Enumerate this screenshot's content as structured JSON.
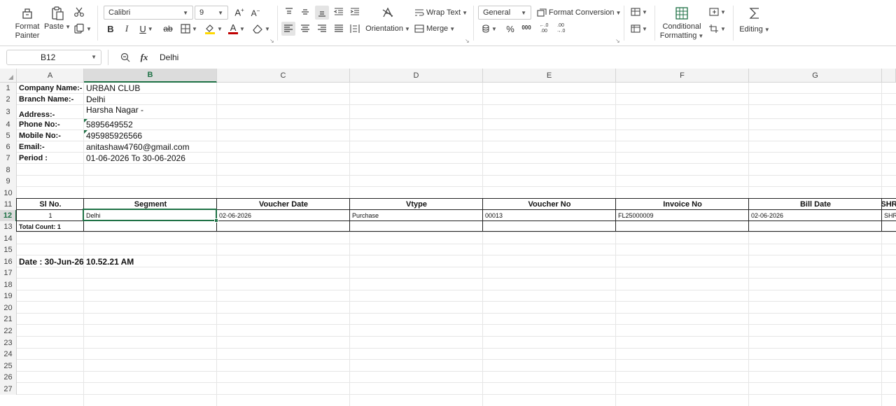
{
  "ribbon": {
    "format_painter_label_1": "Format",
    "format_painter_label_2": "Painter",
    "paste_label": "Paste",
    "font_name": "Calibri",
    "font_size": "9",
    "wrap_text_label": "Wrap Text",
    "orientation_label": "Orientation",
    "merge_label": "Merge",
    "number_format": "General",
    "format_conversion_label": "Format Conversion",
    "conditional_formatting_label_1": "Conditional",
    "conditional_formatting_label_2": "Formatting",
    "editing_label": "Editing",
    "percent_glyph": "%",
    "comma_glyph": "000",
    "increase_decimal_glyph": "←.0 .00",
    "decrease_decimal_glyph": ".00 →.0",
    "bold_glyph": "B",
    "italic_glyph": "I",
    "underline_glyph": "U",
    "strike_glyph": "ab",
    "font_color_glyph": "A",
    "accent_color": "#1e7145",
    "font_color_bar": "#c00000",
    "highlight_color_bar": "#ffd800"
  },
  "formula_bar": {
    "name_box": "B12",
    "formula_value": "Delhi"
  },
  "grid": {
    "columns": [
      "A",
      "B",
      "C",
      "D",
      "E",
      "F",
      "G"
    ],
    "rows": [
      "1",
      "2",
      "3",
      "4",
      "5",
      "6",
      "7",
      "8",
      "9",
      "10",
      "11",
      "12",
      "13",
      "14",
      "15",
      "16",
      "17",
      "18",
      "19",
      "20",
      "21",
      "22",
      "23",
      "24",
      "25",
      "26",
      "27"
    ],
    "active_cell": "B12",
    "info": {
      "company_label": "Company Name:-",
      "company_value": "URBAN CLUB",
      "branch_label": "Branch Name:-",
      "branch_value": "Delhi",
      "address_label": "Address:-",
      "address_value": "Harsha Nagar -",
      "phone_label": "Phone No:-",
      "phone_value": "5895649552",
      "mobile_label": "Mobile No:-",
      "mobile_value": "495985926566",
      "email_label": "Email:-",
      "email_value": "anitashaw4760@gmail.com",
      "period_label": "Period :",
      "period_value": "01-06-2026 To 30-06-2026"
    },
    "table": {
      "headers": [
        "Sl No.",
        "Segment",
        "Voucher Date",
        "Vtype",
        "Voucher No",
        "Invoice No",
        "Bill Date",
        "SHR"
      ],
      "row": [
        "1",
        "Delhi",
        "02-06-2026",
        "Purchase",
        "00013",
        "FL25000009",
        "02-06-2026",
        "SHR"
      ],
      "total_count": "Total Count: 1"
    },
    "report_date": "Date : 30-Jun-26 10.52.21 AM"
  }
}
